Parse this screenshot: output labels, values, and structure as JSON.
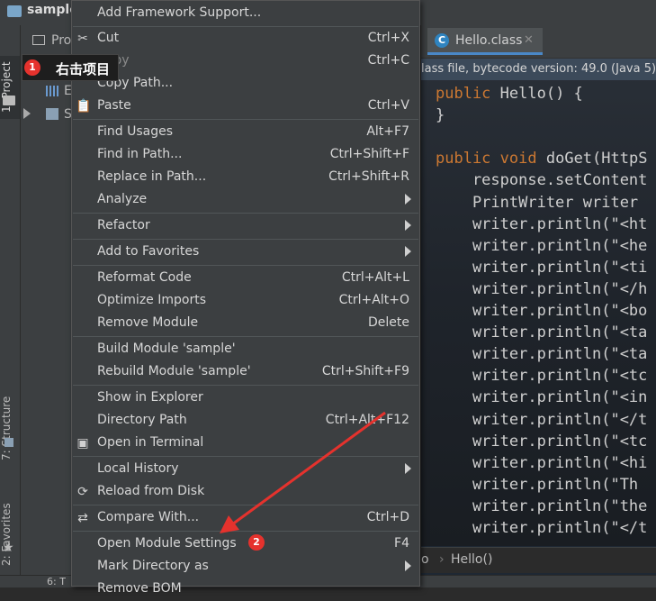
{
  "project": {
    "name": "sample",
    "panel_header": "Pro",
    "tree_stub_1": "E",
    "tree_stub_2": "S"
  },
  "tool_windows": {
    "project": "1: Project",
    "structure": "7: Structure",
    "favorites": "2: Favorites"
  },
  "editor": {
    "tab_label": "Hello.class",
    "tab_icon": "C",
    "tab_close": "✕",
    "info_bar": "lass file, bytecode version: 49.0 (Java 5)",
    "code_lines": [
      "public Hello() {",
      "}",
      "",
      "public void doGet(HttpS",
      "    response.setContent",
      "    PrintWriter writer",
      "    writer.println(\"<ht",
      "    writer.println(\"<he",
      "    writer.println(\"<ti",
      "    writer.println(\"</h",
      "    writer.println(\"<bo",
      "    writer.println(\"<ta",
      "    writer.println(\"<ta",
      "    writer.println(\"<tc",
      "    writer.println(\"<in",
      "    writer.println(\"</t",
      "    writer.println(\"<tc",
      "    writer.println(\"<hi",
      "    writer.println(\"Th",
      "    writer.println(\"the",
      "    writer.println(\"</t"
    ],
    "breadcrumb": [
      "o",
      "Hello()"
    ]
  },
  "bottom_bar": {
    "tab": "6: T"
  },
  "annotations": {
    "step1_number": "1",
    "step1_text": "右击项目",
    "step2_number": "2",
    "arrow_color": "#e5322d"
  },
  "context_menu": {
    "items": [
      {
        "label": "Add Framework Support...",
        "shortcut": ""
      },
      {
        "label": "Cut",
        "shortcut": "Ctrl+X",
        "icon": "scissors-icon"
      },
      {
        "label": "Copy",
        "shortcut": "Ctrl+C",
        "icon": "copy-icon"
      },
      {
        "label": "Copy Path...",
        "shortcut": ""
      },
      {
        "label": "Paste",
        "shortcut": "Ctrl+V",
        "icon": "paste-icon"
      },
      {
        "label": "Find Usages",
        "shortcut": "Alt+F7"
      },
      {
        "label": "Find in Path...",
        "shortcut": "Ctrl+Shift+F"
      },
      {
        "label": "Replace in Path...",
        "shortcut": "Ctrl+Shift+R"
      },
      {
        "label": "Analyze",
        "shortcut": "",
        "submenu": true
      },
      {
        "label": "Refactor",
        "shortcut": "",
        "submenu": true
      },
      {
        "label": "Add to Favorites",
        "shortcut": "",
        "submenu": true
      },
      {
        "label": "Reformat Code",
        "shortcut": "Ctrl+Alt+L"
      },
      {
        "label": "Optimize Imports",
        "shortcut": "Ctrl+Alt+O"
      },
      {
        "label": "Remove Module",
        "shortcut": "Delete"
      },
      {
        "label": "Build Module 'sample'",
        "shortcut": ""
      },
      {
        "label": "Rebuild Module 'sample'",
        "shortcut": "Ctrl+Shift+F9"
      },
      {
        "label": "Show in Explorer",
        "shortcut": ""
      },
      {
        "label": "Directory Path",
        "shortcut": "Ctrl+Alt+F12"
      },
      {
        "label": "Open in Terminal",
        "shortcut": "",
        "icon": "terminal-icon"
      },
      {
        "label": "Local History",
        "shortcut": "",
        "submenu": true
      },
      {
        "label": "Reload from Disk",
        "shortcut": "",
        "icon": "reload-icon"
      },
      {
        "label": "Compare With...",
        "shortcut": "Ctrl+D",
        "icon": "compare-icon"
      },
      {
        "label": "Open Module Settings",
        "shortcut": "F4"
      },
      {
        "label": "Mark Directory as",
        "shortcut": "",
        "submenu": true
      },
      {
        "label": "Remove BOM",
        "shortcut": ""
      }
    ]
  }
}
